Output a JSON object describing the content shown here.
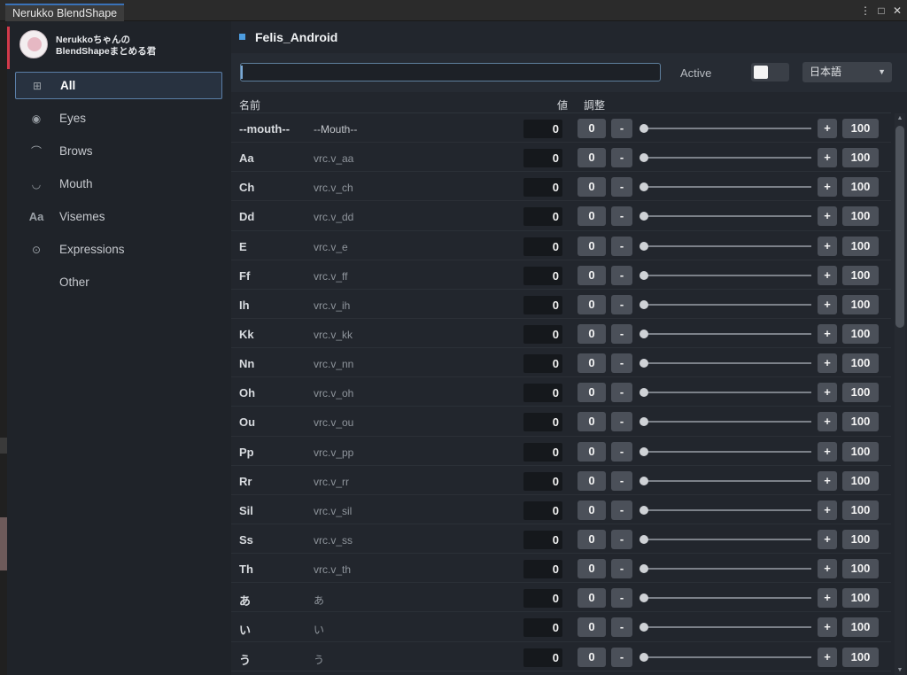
{
  "window": {
    "tab_title": "Nerukko BlendShape",
    "controls": [
      "⋮",
      "□",
      "✕"
    ]
  },
  "sidebar": {
    "brand_line1": "Nerukkoちゃんの",
    "brand_line2": "BlendShapeまとめる君",
    "items": [
      {
        "label": "All",
        "icon": "grid-icon",
        "glyph": "⊞",
        "active": true
      },
      {
        "label": "Eyes",
        "icon": "eye-icon",
        "glyph": "◉",
        "active": false
      },
      {
        "label": "Brows",
        "icon": "brow-icon",
        "glyph": "⌒",
        "active": false
      },
      {
        "label": "Mouth",
        "icon": "mouth-icon",
        "glyph": "◡",
        "active": false
      },
      {
        "label": "Visemes",
        "icon": "text-icon",
        "glyph": "Aa",
        "active": false
      },
      {
        "label": "Expressions",
        "icon": "face-icon",
        "glyph": "⊙",
        "active": false
      },
      {
        "label": "Other",
        "icon": "",
        "glyph": "",
        "active": false
      }
    ]
  },
  "main": {
    "title": "Felis_Android",
    "search": {
      "value": "",
      "placeholder": ""
    },
    "active_label": "Active",
    "active_toggle": true,
    "language": "日本語",
    "columns": {
      "name": "名前",
      "value": "値",
      "adjust": "調整"
    },
    "rows": [
      {
        "name": "--mouth--",
        "key": "--Mouth--",
        "value": "0",
        "slider": 0
      },
      {
        "name": "Aa",
        "key": "vrc.v_aa",
        "value": "0",
        "slider": 0
      },
      {
        "name": "Ch",
        "key": "vrc.v_ch",
        "value": "0",
        "slider": 0
      },
      {
        "name": "Dd",
        "key": "vrc.v_dd",
        "value": "0",
        "slider": 0
      },
      {
        "name": "E",
        "key": "vrc.v_e",
        "value": "0",
        "slider": 0
      },
      {
        "name": "Ff",
        "key": "vrc.v_ff",
        "value": "0",
        "slider": 0
      },
      {
        "name": "Ih",
        "key": "vrc.v_ih",
        "value": "0",
        "slider": 0
      },
      {
        "name": "Kk",
        "key": "vrc.v_kk",
        "value": "0",
        "slider": 0
      },
      {
        "name": "Nn",
        "key": "vrc.v_nn",
        "value": "0",
        "slider": 0
      },
      {
        "name": "Oh",
        "key": "vrc.v_oh",
        "value": "0",
        "slider": 0
      },
      {
        "name": "Ou",
        "key": "vrc.v_ou",
        "value": "0",
        "slider": 0
      },
      {
        "name": "Pp",
        "key": "vrc.v_pp",
        "value": "0",
        "slider": 0
      },
      {
        "name": "Rr",
        "key": "vrc.v_rr",
        "value": "0",
        "slider": 0
      },
      {
        "name": "Sil",
        "key": "vrc.v_sil",
        "value": "0",
        "slider": 0
      },
      {
        "name": "Ss",
        "key": "vrc.v_ss",
        "value": "0",
        "slider": 0
      },
      {
        "name": "Th",
        "key": "vrc.v_th",
        "value": "0",
        "slider": 0
      },
      {
        "name": "あ",
        "key": "あ",
        "value": "0",
        "slider": 0
      },
      {
        "name": "い",
        "key": "い",
        "value": "0",
        "slider": 0
      },
      {
        "name": "う",
        "key": "う",
        "value": "0",
        "slider": 0
      }
    ],
    "btn_zero": "0",
    "btn_minus": "-",
    "btn_plus": "+",
    "btn_max": "100"
  },
  "colors": {
    "accent": "#4d9de0",
    "brand_bar": "#d33a4a",
    "active_nav_border": "#5b7fa8"
  }
}
